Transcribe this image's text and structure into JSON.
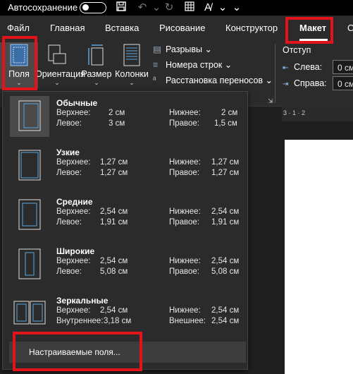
{
  "titlebar": {
    "autosave_label": "Автосохранение"
  },
  "tabs": [
    "Файл",
    "Главная",
    "Вставка",
    "Рисование",
    "Конструктор",
    "Макет",
    "С"
  ],
  "ribbon": {
    "margins_label": "Поля",
    "orientation_label": "Ориентация",
    "size_label": "Размер",
    "columns_label": "Колонки",
    "breaks_label": "Разрывы",
    "line_numbers_label": "Номера строк",
    "hyphenation_label": "Расстановка переносов",
    "indent_title": "Отступ",
    "indent_left_label": "Слева:",
    "indent_right_label": "Справа:",
    "indent_left_value": "0 см",
    "indent_right_value": "0 см"
  },
  "ruler_text": "3 · 1 · 2",
  "margins_menu": {
    "items": [
      {
        "name": "Обычные",
        "k1": "Верхнее:",
        "v1": "2 см",
        "k2": "Нижнее:",
        "v2": "2 см",
        "k3": "Левое:",
        "v3": "3 см",
        "k4": "Правое:",
        "v4": "1,5 см"
      },
      {
        "name": "Узкие",
        "k1": "Верхнее:",
        "v1": "1,27 см",
        "k2": "Нижнее:",
        "v2": "1,27 см",
        "k3": "Левое:",
        "v3": "1,27 см",
        "k4": "Правое:",
        "v4": "1,27 см"
      },
      {
        "name": "Средние",
        "k1": "Верхнее:",
        "v1": "2,54 см",
        "k2": "Нижнее:",
        "v2": "2,54 см",
        "k3": "Левое:",
        "v3": "1,91 см",
        "k4": "Правое:",
        "v4": "1,91 см"
      },
      {
        "name": "Широкие",
        "k1": "Верхнее:",
        "v1": "2,54 см",
        "k2": "Нижнее:",
        "v2": "2,54 см",
        "k3": "Левое:",
        "v3": "5,08 см",
        "k4": "Правое:",
        "v4": "5,08 см"
      },
      {
        "name": "Зеркальные",
        "k1": "Верхнее:",
        "v1": "2,54 см",
        "k2": "Нижнее:",
        "v2": "2,54 см",
        "k3": "Внутреннее:",
        "v3": "3,18 см",
        "k4": "Внешнее:",
        "v4": "2,54 см"
      }
    ],
    "custom_label": "Настраиваемые поля..."
  },
  "colors": {
    "highlight": "#e0141a",
    "accent_icon": "#5aa7e0"
  }
}
